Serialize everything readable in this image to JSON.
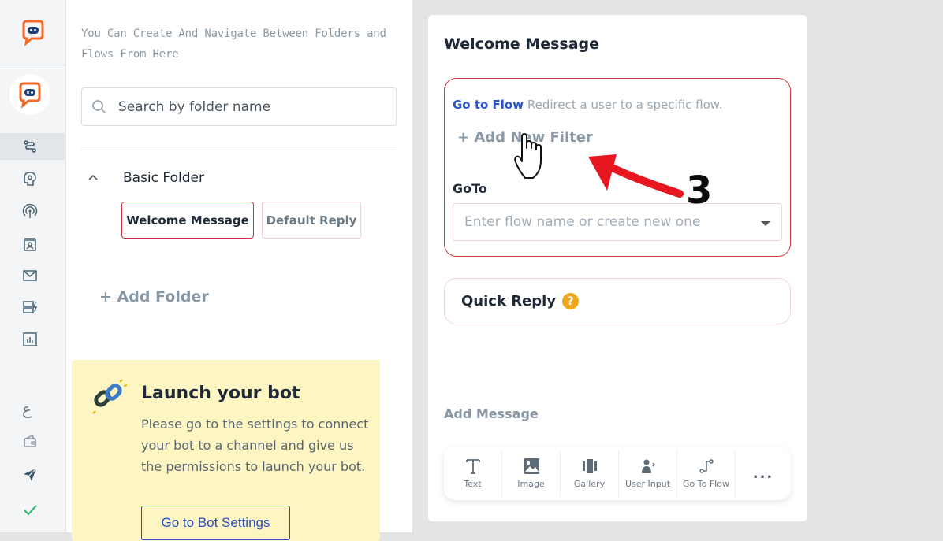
{
  "sidebar": {
    "icons": [
      "brand-logo-icon",
      "bot-avatar-icon",
      "flows-icon",
      "settings-brain-icon",
      "broadcast-icon",
      "contacts-icon",
      "mail-icon",
      "storage-icon",
      "analytics-icon",
      "arabic-language-icon",
      "wallet-icon",
      "send-icon",
      "check-icon"
    ],
    "colors": {
      "brand": "#f46a2b",
      "active_bg": "#e2e6ea",
      "check": "#2fb36a"
    }
  },
  "folders_panel": {
    "hint": "You Can Create And Navigate Between Folders and Flows From Here",
    "search_placeholder": "Search by folder name",
    "folder_name": "Basic Folder",
    "flows": [
      "Welcome Message",
      "Default Reply"
    ],
    "add_folder": "+ Add Folder"
  },
  "launch_card": {
    "title": "Launch your bot",
    "description": "Please go to the settings to connect your bot to a channel and give us the permissions to launch your bot.",
    "button": "Go to Bot Settings"
  },
  "editor": {
    "title": "Welcome Message",
    "goto_block": {
      "intro_strong": "Go to Flow",
      "intro_rest": " Redirect a user to a specific flow.",
      "add_filter": "+ Add New Filter",
      "goto_label": "GoTo",
      "select_placeholder": "Enter flow name or create new one"
    },
    "quick_reply": {
      "label": "Quick Reply",
      "help": "?"
    },
    "add_message": "Add Message",
    "tools": [
      "Text",
      "Image",
      "Gallery",
      "User Input",
      "Go To Flow"
    ],
    "more": "..."
  },
  "annotation": {
    "step": "3",
    "arrow_color": "#e8161e"
  }
}
